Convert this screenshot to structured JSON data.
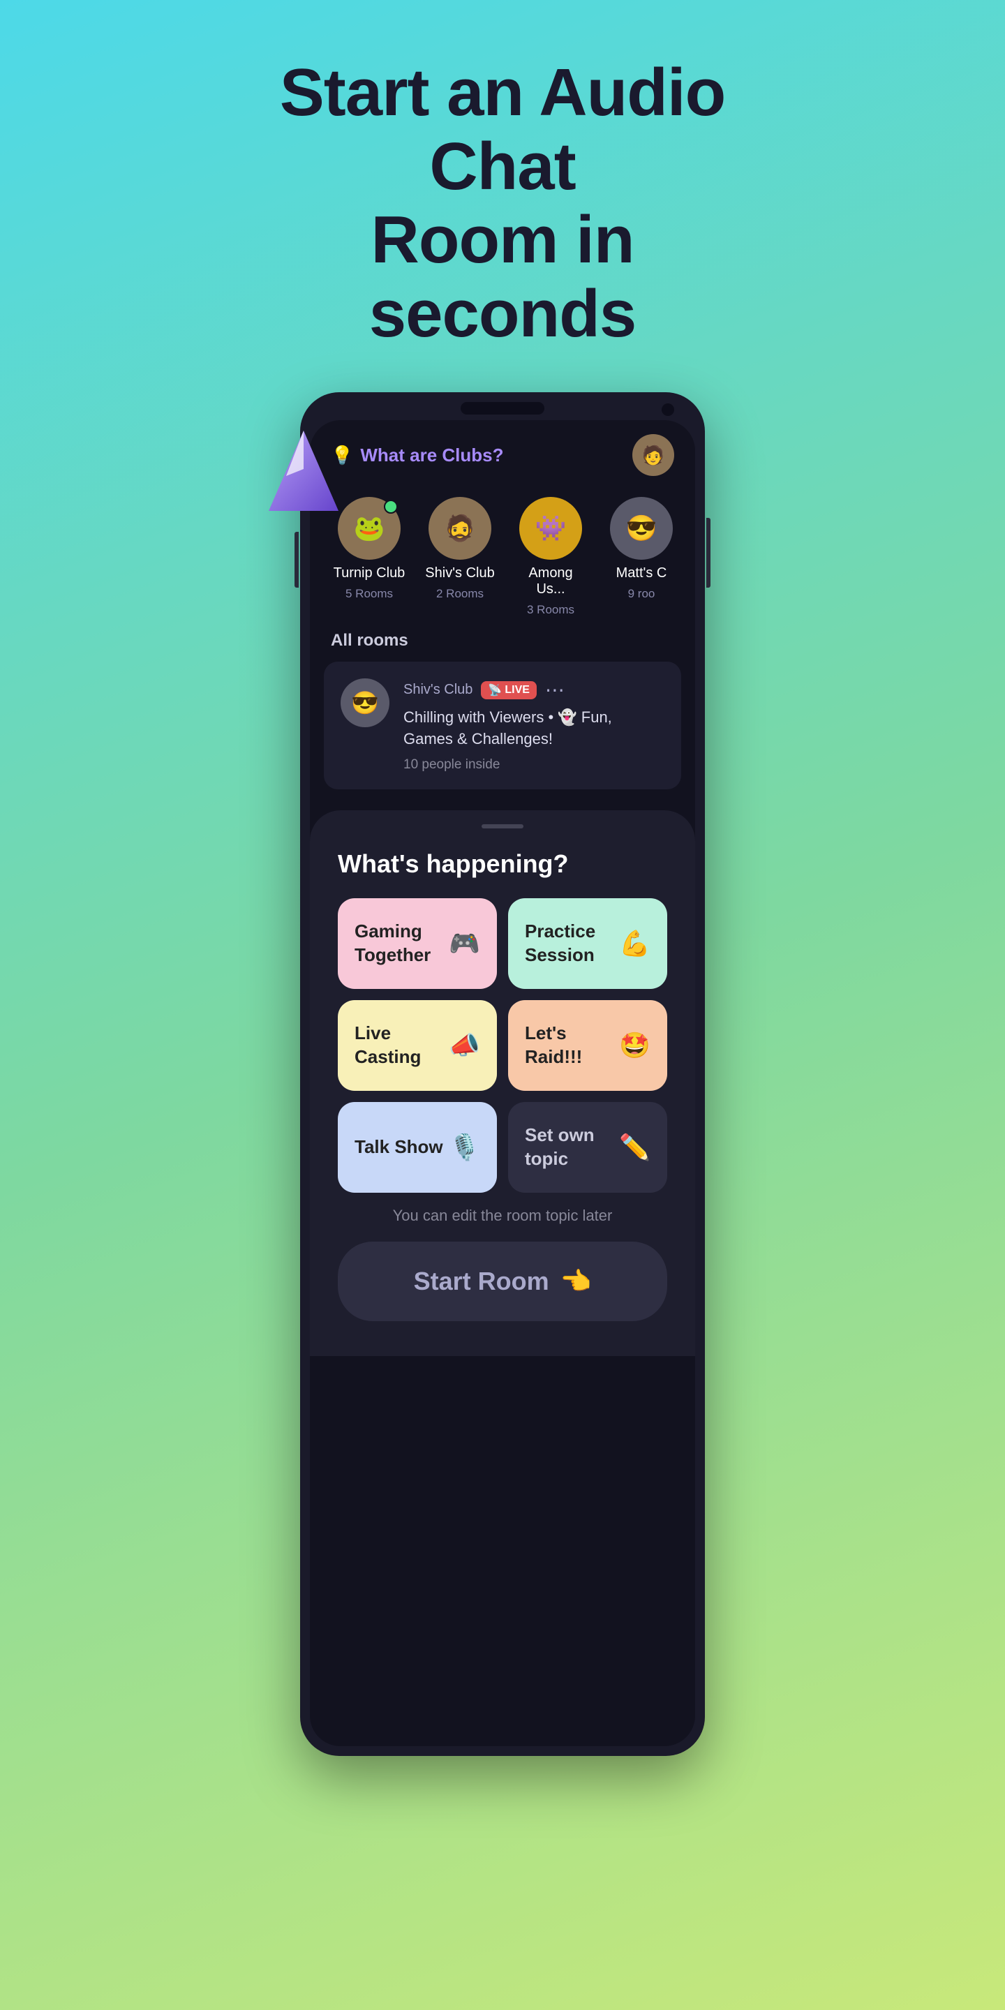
{
  "headline": {
    "line1": "Start an Audio Chat",
    "line2": "Room in seconds"
  },
  "app": {
    "clubs_link": "What are Clubs?",
    "clubs_link_icon": "💡",
    "all_rooms_label": "All rooms",
    "clubs": [
      {
        "name": "Turnip Club",
        "rooms": "5 Rooms",
        "emoji": "🐸",
        "bg": "brown",
        "online": true
      },
      {
        "name": "Shiv's Club",
        "rooms": "2 Rooms",
        "emoji": "🧔",
        "bg": "brown",
        "online": false
      },
      {
        "name": "Among Us...",
        "rooms": "3 Rooms",
        "emoji": "👾",
        "bg": "yellow",
        "online": false
      },
      {
        "name": "Matt's C",
        "rooms": "9 roo",
        "emoji": "😎",
        "bg": "gray",
        "online": false
      }
    ],
    "room": {
      "club": "Shiv's Club",
      "live": "LIVE",
      "live_icon": "📡",
      "description": "Chilling with Viewers • 👻 Fun, Games & Challenges!",
      "people": "10 people inside"
    }
  },
  "sheet": {
    "handle": "",
    "title": "What's happening?",
    "edit_hint": "You can edit the room topic later",
    "start_label": "Start Room",
    "start_emoji": "👈",
    "topics": [
      {
        "label": "Gaming Together",
        "emoji": "🎮",
        "color": "pink"
      },
      {
        "label": "Practice Session",
        "emoji": "💪",
        "color": "mint"
      },
      {
        "label": "Live Casting",
        "emoji": "📣",
        "color": "yellow"
      },
      {
        "label": "Let's Raid!!!",
        "emoji": "🤩",
        "color": "peach"
      },
      {
        "label": "Talk Show",
        "emoji": "🎙️",
        "color": "lavender"
      },
      {
        "label": "Set own topic",
        "emoji": "✏️",
        "color": "dark"
      }
    ]
  }
}
